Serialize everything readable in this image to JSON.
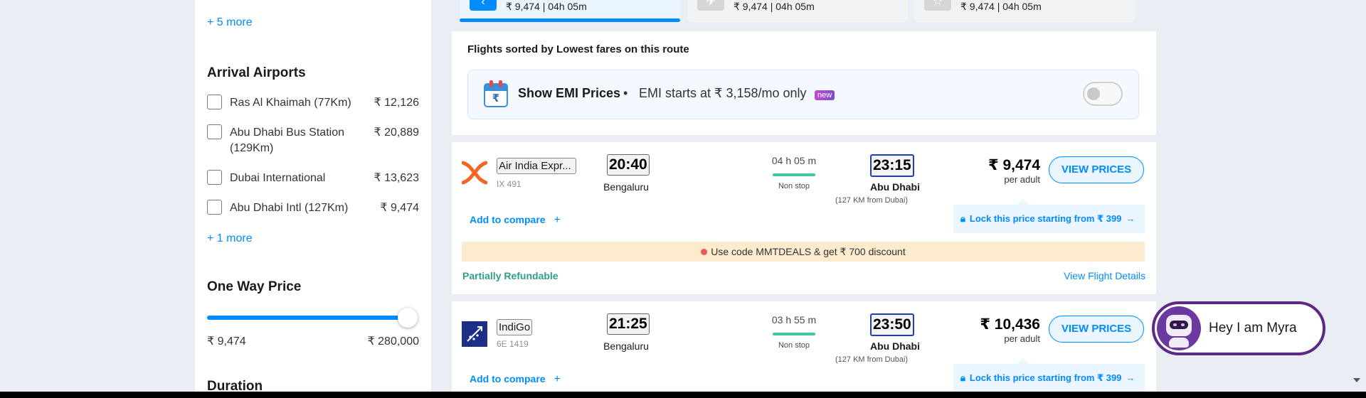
{
  "sidebar": {
    "more_top": "+ 5 more",
    "arrival_title": "Arrival Airports",
    "airports": [
      {
        "name": "Ras Al Khaimah (77Km)",
        "price": "₹ 12,126"
      },
      {
        "name": "Abu Dhabi Bus Station (129Km)",
        "price": "₹ 20,889"
      },
      {
        "name": "Dubai International",
        "price": "₹ 13,623"
      },
      {
        "name": "Abu Dhabi Intl (127Km)",
        "price": "₹ 9,474"
      }
    ],
    "more_bottom": "+ 1 more",
    "price_title": "One Way Price",
    "price_min": "₹ 9,474",
    "price_max": "₹ 280,000",
    "price_slider_fraction": 1.0,
    "duration_title": "Duration"
  },
  "date_tabs": [
    {
      "text": "₹ 9,474 | 04h 05m",
      "active": true
    },
    {
      "text": "₹ 9,474 | 04h 05m",
      "active": false
    },
    {
      "text": "₹ 9,474 | 04h 05m",
      "active": false
    }
  ],
  "sort_title": "Flights sorted by Lowest fares on this route",
  "emi": {
    "title": "Show EMI Prices",
    "separator": "•",
    "subtitle": "EMI starts at ₹ 3,158/mo only",
    "badge": "new",
    "toggle_on": false
  },
  "flights": [
    {
      "airline": "Air India Expr...",
      "code": "IX 491",
      "dep_time": "20:40",
      "dep_city": "Bengaluru",
      "duration": "04 h 05 m",
      "stops": "Non stop",
      "arr_time": "23:15",
      "arr_city": "Abu Dhabi",
      "arr_note": "(127 KM from Dubai)",
      "price": "₹ 9,474",
      "per_adult": "per adult",
      "view_prices": "VIEW PRICES",
      "add_compare": "Add to compare",
      "lock_text": "Lock this price starting from ₹ 399",
      "deal": "Use code MMTDEALS & get ₹ 700 discount",
      "refundable": "Partially Refundable",
      "view_details": "View Flight Details"
    },
    {
      "airline": "IndiGo",
      "code": "6E 1419",
      "dep_time": "21:25",
      "dep_city": "Bengaluru",
      "duration": "03 h 55 m",
      "stops": "Non stop",
      "arr_time": "23:50",
      "arr_city": "Abu Dhabi",
      "arr_note": "(127 KM from Dubai)",
      "price": "₹ 10,436",
      "per_adult": "per adult",
      "view_prices": "VIEW PRICES",
      "add_compare": "Add to compare",
      "lock_text": "Lock this price starting from ₹ 399"
    }
  ],
  "chat": {
    "text": "Hey I am Myra"
  },
  "colors": {
    "accent": "#008cff",
    "refundable": "#2c9f89",
    "duration_line": "#44c6a6",
    "deal_bg": "#fdebcd",
    "chat_border": "#5b2a86"
  }
}
